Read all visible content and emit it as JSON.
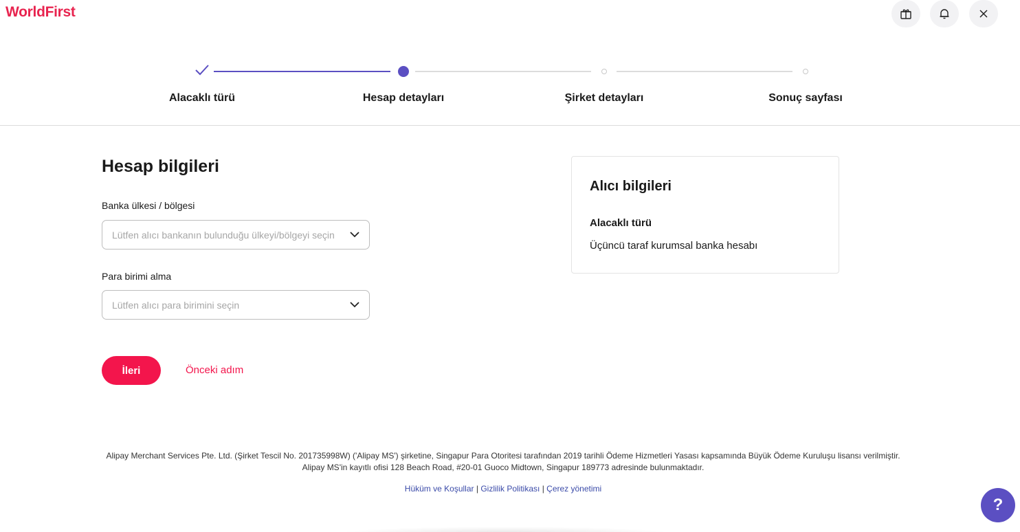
{
  "header": {
    "logo": "WorldFirst",
    "icons": [
      "gift-icon",
      "bell-icon",
      "close-icon"
    ]
  },
  "stepper": {
    "steps": [
      {
        "label": "Alacaklı türü",
        "state": "completed"
      },
      {
        "label": "Hesap detayları",
        "state": "current"
      },
      {
        "label": "Şirket detayları",
        "state": "upcoming"
      },
      {
        "label": "Sonuç sayfası",
        "state": "upcoming"
      }
    ]
  },
  "form": {
    "title": "Hesap bilgileri",
    "bank_country": {
      "label": "Banka ülkesi / bölgesi",
      "placeholder": "Lütfen alıcı bankanın bulunduğu ülkeyi/bölgeyi seçin"
    },
    "currency": {
      "label": "Para birimi alma",
      "placeholder": "Lütfen alıcı para birimini seçin"
    },
    "next_label": "İleri",
    "prev_label": "Önceki adım"
  },
  "card": {
    "title": "Alıcı bilgileri",
    "subtitle": "Alacaklı türü",
    "value": "Üçüncü taraf kurumsal banka hesabı"
  },
  "footer": {
    "line1": "Alipay Merchant Services Pte. Ltd. (Şirket Tescil No. 201735998W) ('Alipay MS') şirketine, Singapur Para Otoritesi tarafından 2019 tarihli Ödeme Hizmetleri Yasası kapsamında Büyük Ödeme Kuruluşu lisansı verilmiştir.",
    "line2": "Alipay MS'in kayıtlı ofisi 128 Beach Road, #20-01 Guoco Midtown, Singapur 189773 adresinde bulunmaktadır.",
    "links": [
      "Hüküm ve Koşullar",
      "Gizlilik Politikası",
      "Çerez yönetimi"
    ],
    "separator": "|"
  },
  "help": {
    "label": "?"
  },
  "colors": {
    "brand": "#e8244f",
    "accent": "#5b4fc2",
    "primary_button": "#f3154c",
    "link": "#3a4aa8"
  }
}
